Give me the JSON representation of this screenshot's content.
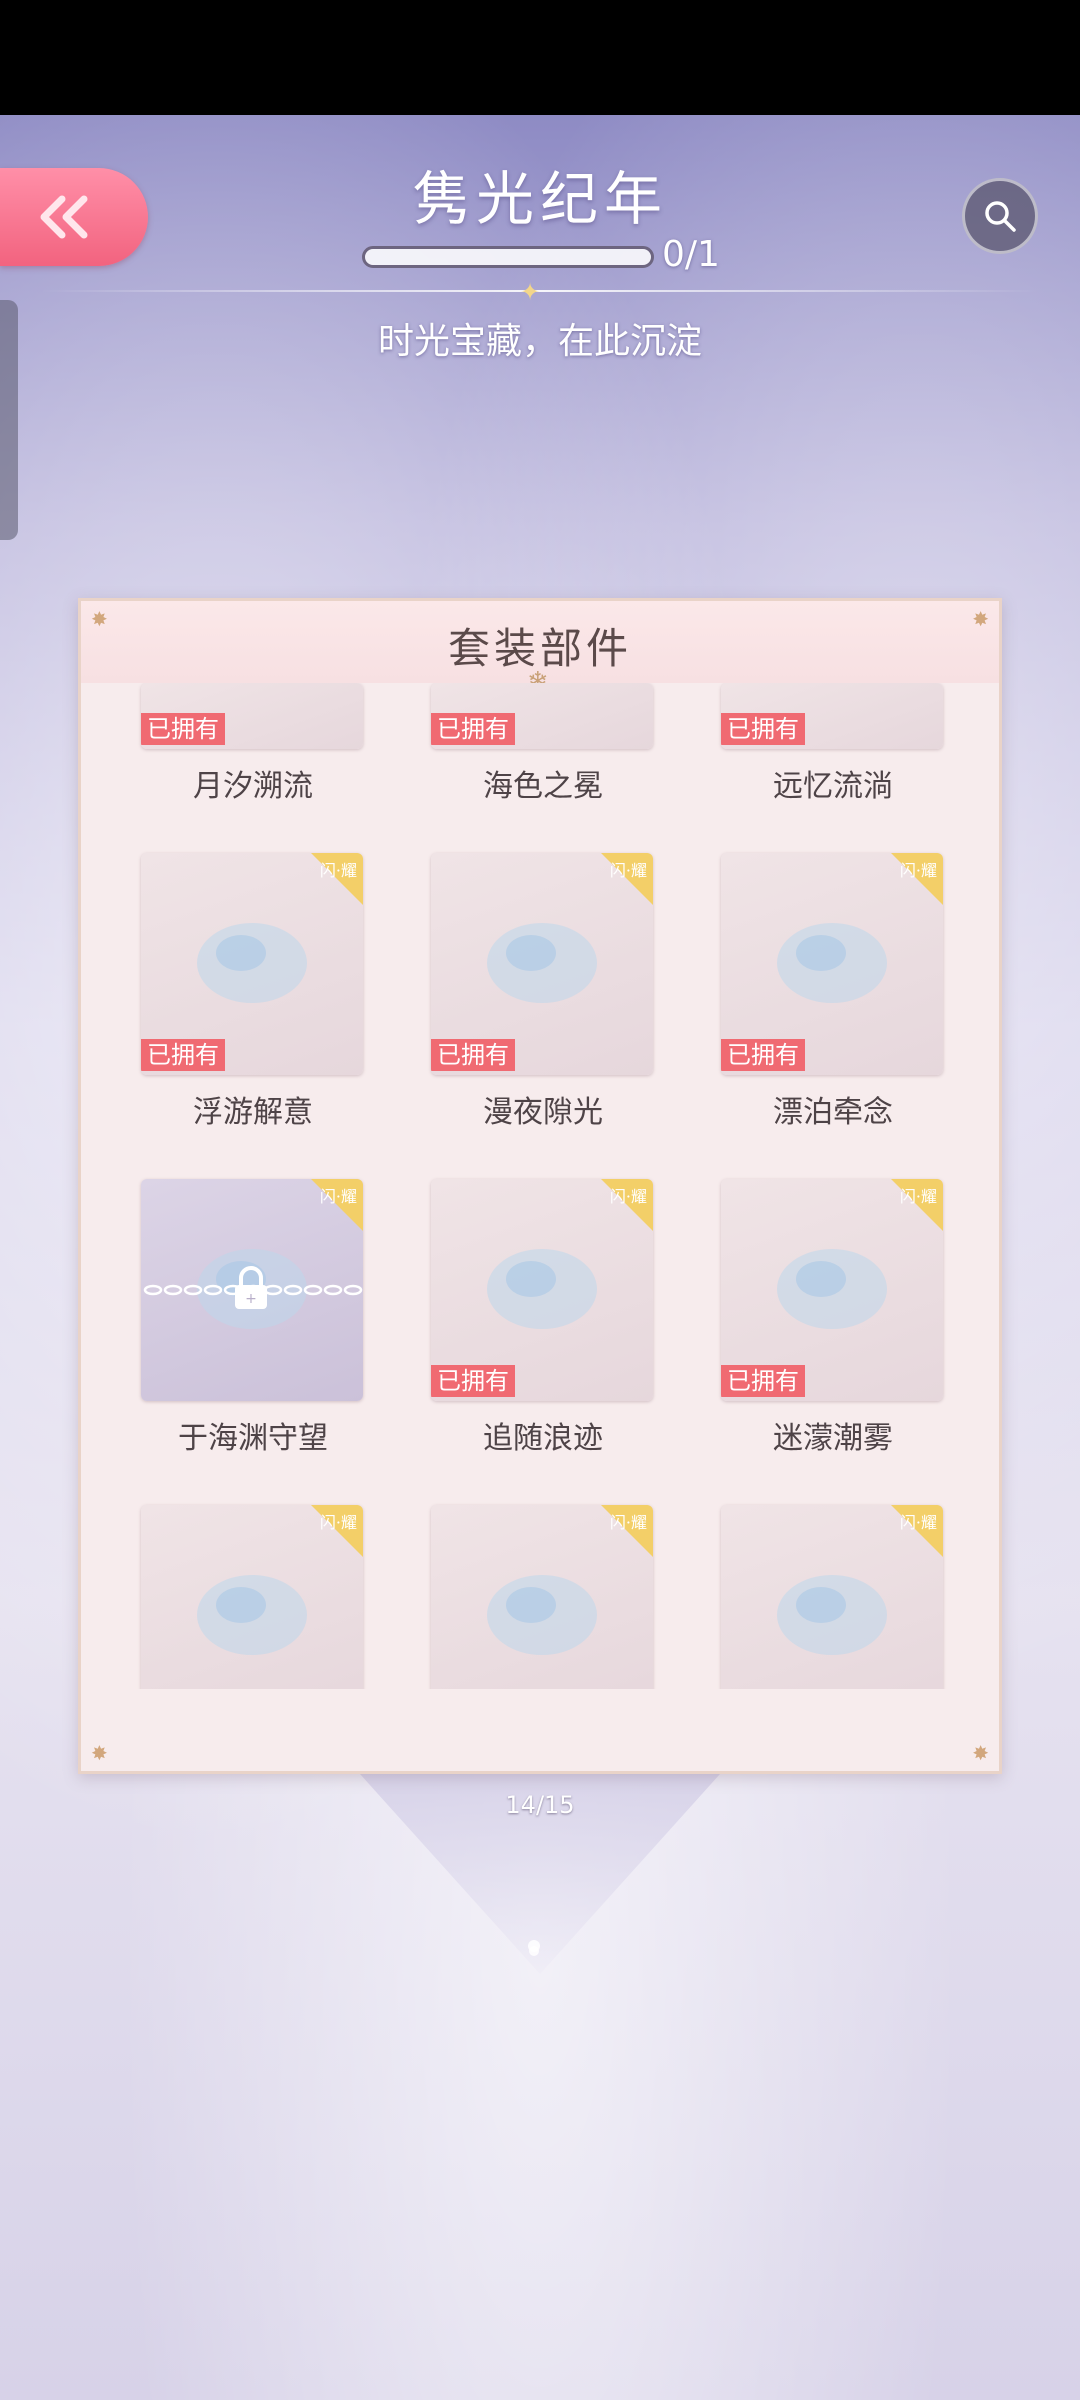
{
  "header": {
    "title": "隽光纪年",
    "progress_text": "0/1",
    "progress_fraction": 0,
    "subtitle": "时光宝藏，在此沉淀"
  },
  "icons": {
    "back": "double-chevron-left-icon",
    "search": "magnifier-icon",
    "lock": "padlock-icon"
  },
  "colors": {
    "back_button": "#f2637f",
    "owned_tag": "#f06a72",
    "corner_badge": "#f3cf68",
    "panel_bg": "#f7eced"
  },
  "panel": {
    "title": "套装部件",
    "owned_label": "已拥有",
    "badge_text": "闪·耀",
    "rows": [
      {
        "items": [
          {
            "name": "月汐溯流",
            "owned": true,
            "badge": false,
            "locked": false
          },
          {
            "name": "海色之冕",
            "owned": true,
            "badge": false,
            "locked": false
          },
          {
            "name": "远忆流淌",
            "owned": true,
            "badge": false,
            "locked": false
          }
        ]
      },
      {
        "items": [
          {
            "name": "浮游解意",
            "owned": true,
            "badge": true,
            "locked": false
          },
          {
            "name": "漫夜隙光",
            "owned": true,
            "badge": true,
            "locked": false
          },
          {
            "name": "漂泊牵念",
            "owned": true,
            "badge": true,
            "locked": false
          }
        ]
      },
      {
        "items": [
          {
            "name": "于海渊守望",
            "owned": false,
            "badge": true,
            "locked": true
          },
          {
            "name": "追随浪迹",
            "owned": true,
            "badge": true,
            "locked": false
          },
          {
            "name": "迷濛潮雾",
            "owned": true,
            "badge": true,
            "locked": false
          }
        ]
      },
      {
        "items": [
          {
            "name": "",
            "owned": true,
            "badge": true,
            "locked": false
          },
          {
            "name": "",
            "owned": true,
            "badge": true,
            "locked": false
          },
          {
            "name": "",
            "owned": true,
            "badge": true,
            "locked": false
          }
        ]
      }
    ]
  },
  "pager": {
    "text": "14/15"
  }
}
